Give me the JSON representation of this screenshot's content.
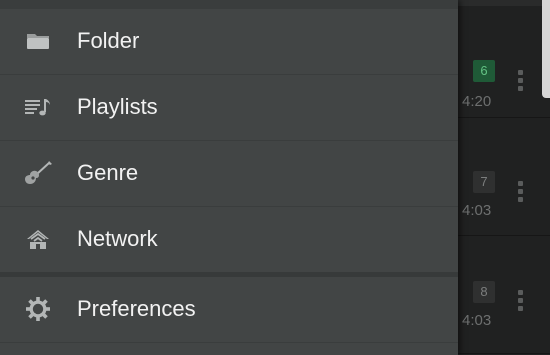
{
  "drawer": {
    "items": [
      {
        "label": "Folder",
        "icon": "folder-icon"
      },
      {
        "label": "Playlists",
        "icon": "playlist-icon"
      },
      {
        "label": "Genre",
        "icon": "guitar-icon"
      },
      {
        "label": "Network",
        "icon": "network-icon"
      }
    ],
    "settings_item": {
      "label": "Preferences",
      "icon": "gear-icon"
    }
  },
  "track_list": {
    "rows": [
      {
        "track_number": "6",
        "duration": "4:20",
        "active": true
      },
      {
        "track_number": "7",
        "duration": "4:03",
        "active": false
      },
      {
        "track_number": "8",
        "duration": "4:03",
        "active": false
      }
    ]
  },
  "colors": {
    "drawer_background": "#424545",
    "drawer_text": "#f2f2f2",
    "icon_color": "#b3b6b6",
    "active_badge_background": "#1f5a37",
    "active_badge_text": "#63c284",
    "list_background": "#202121"
  }
}
